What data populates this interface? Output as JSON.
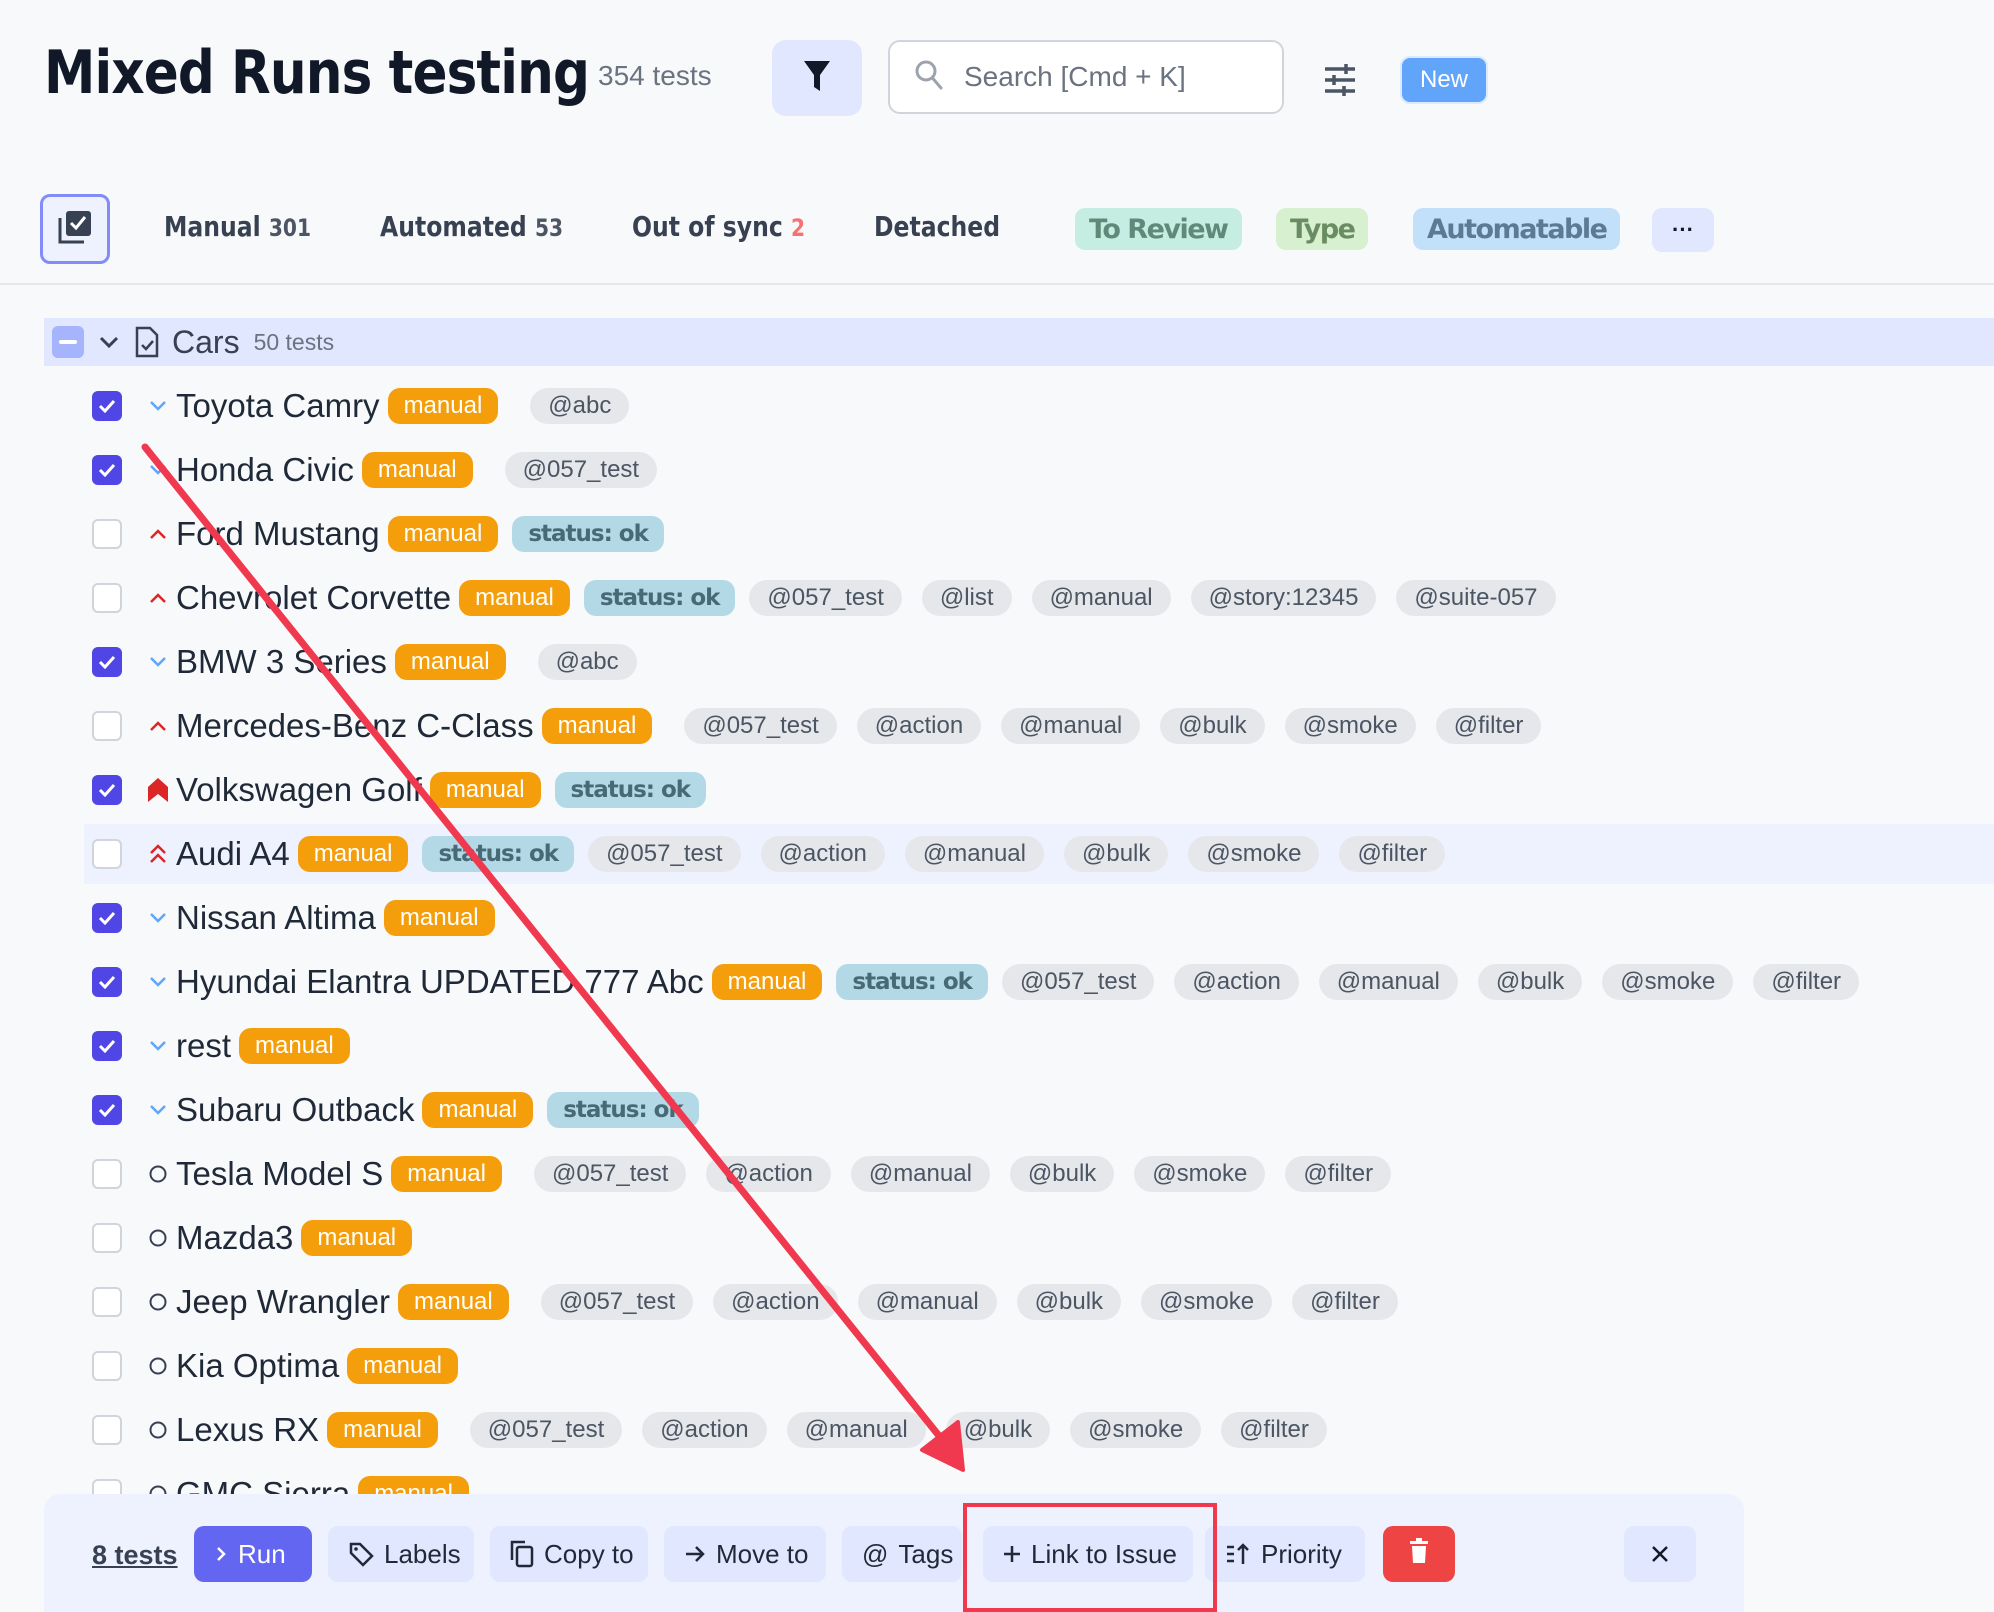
{
  "header": {
    "title": "Mixed Runs testing",
    "count": "354 tests",
    "search_placeholder": "Search [Cmd + K]",
    "new_badge": "New"
  },
  "tabs": [
    {
      "label": "Manual",
      "count": "301"
    },
    {
      "label": "Automated",
      "count": "53"
    },
    {
      "label": "Out of sync",
      "count": "2"
    },
    {
      "label": "Detached",
      "count": ""
    }
  ],
  "label_filters": [
    {
      "label": "To Review",
      "bg": "#c6ede1",
      "fg": "#5f8a7a"
    },
    {
      "label": "Type",
      "bg": "#d6f0d0",
      "fg": "#6a8c62"
    },
    {
      "label": "Automatable",
      "bg": "#c3e0fb",
      "fg": "#5c7a96"
    }
  ],
  "more_label": "···",
  "group": {
    "name": "Cars",
    "count": "50 tests"
  },
  "tests": [
    {
      "name": "Toyota Camry",
      "checked": true,
      "priority": "low",
      "type": "manual",
      "status": "",
      "tags": [
        "@abc"
      ]
    },
    {
      "name": "Honda Civic",
      "checked": true,
      "priority": "low",
      "type": "manual",
      "status": "",
      "tags": [
        "@057_test"
      ]
    },
    {
      "name": "Ford Mustang",
      "checked": false,
      "priority": "high",
      "type": "manual",
      "status": "status: ok",
      "tags": []
    },
    {
      "name": "Chevrolet Corvette",
      "checked": false,
      "priority": "high",
      "type": "manual",
      "status": "status: ok",
      "tags": [
        "@057_test",
        "@list",
        "@manual",
        "@story:12345",
        "@suite-057"
      ]
    },
    {
      "name": "BMW 3 Series",
      "checked": true,
      "priority": "low",
      "type": "manual",
      "status": "",
      "tags": [
        "@abc"
      ]
    },
    {
      "name": "Mercedes-Benz C-Class",
      "checked": false,
      "priority": "high",
      "type": "manual",
      "status": "",
      "tags": [
        "@057_test",
        "@action",
        "@manual",
        "@bulk",
        "@smoke",
        "@filter"
      ]
    },
    {
      "name": "Volkswagen Golf",
      "checked": true,
      "priority": "critical",
      "type": "manual",
      "status": "status: ok",
      "tags": []
    },
    {
      "name": "Audi A4",
      "checked": false,
      "priority": "important",
      "type": "manual",
      "status": "status: ok",
      "tags": [
        "@057_test",
        "@action",
        "@manual",
        "@bulk",
        "@smoke",
        "@filter"
      ],
      "highlighted": true
    },
    {
      "name": "Nissan Altima",
      "checked": true,
      "priority": "low",
      "type": "manual",
      "status": "",
      "tags": []
    },
    {
      "name": "Hyundai Elantra UPDATED 777 Abc",
      "checked": true,
      "priority": "low",
      "type": "manual",
      "status": "status: ok",
      "tags": [
        "@057_test",
        "@action",
        "@manual",
        "@bulk",
        "@smoke",
        "@filter"
      ]
    },
    {
      "name": "rest",
      "checked": true,
      "priority": "low",
      "type": "manual",
      "status": "",
      "tags": []
    },
    {
      "name": "Subaru Outback",
      "checked": true,
      "priority": "low",
      "type": "manual",
      "status": "status: ok",
      "tags": []
    },
    {
      "name": "Tesla Model S",
      "checked": false,
      "priority": "normal",
      "type": "manual",
      "status": "",
      "tags": [
        "@057_test",
        "@action",
        "@manual",
        "@bulk",
        "@smoke",
        "@filter"
      ]
    },
    {
      "name": "Mazda3",
      "checked": false,
      "priority": "normal",
      "type": "manual",
      "status": "",
      "tags": []
    },
    {
      "name": "Jeep Wrangler",
      "checked": false,
      "priority": "normal",
      "type": "manual",
      "status": "",
      "tags": [
        "@057_test",
        "@action",
        "@manual",
        "@bulk",
        "@smoke",
        "@filter"
      ]
    },
    {
      "name": "Kia Optima",
      "checked": false,
      "priority": "normal",
      "type": "manual",
      "status": "",
      "tags": []
    },
    {
      "name": "Lexus RX",
      "checked": false,
      "priority": "normal",
      "type": "manual",
      "status": "",
      "tags": [
        "@057_test",
        "@action",
        "@manual",
        "@bulk",
        "@smoke",
        "@filter"
      ]
    },
    {
      "name": "GMC Sierra",
      "checked": false,
      "priority": "normal",
      "type": "manual",
      "status": "",
      "tags": []
    }
  ],
  "toolbar": {
    "selected_count": "8 tests",
    "run": "Run",
    "labels": "Labels",
    "copy_to": "Copy to",
    "move_to": "Move to",
    "tags": "Tags",
    "link_to_issue": "Link to Issue",
    "priority": "Priority"
  },
  "colors": {
    "accent": "#6366f1",
    "checkbox_checked": "#4f46e5",
    "manual_badge": "#f59e0b",
    "status_badge": "#b3d9e6",
    "tag_bg": "#e5e7eb",
    "danger": "#ef4444",
    "annotation": "#f0394e",
    "priority_low": "#60a5fa",
    "priority_high": "#dc2626"
  }
}
